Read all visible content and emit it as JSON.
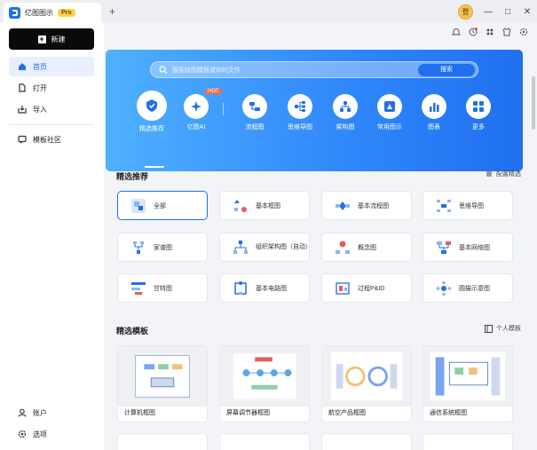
{
  "app": {
    "title": "亿图图示",
    "badge": "Pro",
    "new_tab_symbol": "+",
    "avatar_text": "登"
  },
  "window_controls": {
    "minimize": "—",
    "maximize": "□",
    "close": "✕"
  },
  "sidebar": {
    "new_button": "新建",
    "items": [
      {
        "label": "首页",
        "icon": "home-icon",
        "active": true
      },
      {
        "label": "打开",
        "icon": "open-file-icon"
      },
      {
        "label": "导入",
        "icon": "import-icon"
      },
      {
        "label": "模板社区",
        "icon": "community-icon"
      }
    ],
    "bottom": [
      {
        "label": "账户",
        "icon": "account-icon"
      },
      {
        "label": "选项",
        "icon": "settings-icon"
      }
    ]
  },
  "search": {
    "placeholder": "搜索绘图模板或你的文件",
    "button": "搜索"
  },
  "categories": [
    {
      "label": "精选推荐",
      "icon": "recommend-icon"
    },
    {
      "label": "亿图AI",
      "icon": "ai-icon",
      "badge": "HOT"
    },
    {
      "label": "流程图",
      "icon": "flowchart-icon"
    },
    {
      "label": "思维导图",
      "icon": "mindmap-icon"
    },
    {
      "label": "架构图",
      "icon": "architecture-icon"
    },
    {
      "label": "常用图示",
      "icon": "common-diagram-icon"
    },
    {
      "label": "图表",
      "icon": "chart-icon"
    },
    {
      "label": "更多",
      "icon": "more-icon"
    }
  ],
  "featured": {
    "title": "精选推荐",
    "config_link": "配置精选",
    "items": [
      {
        "label": "全部"
      },
      {
        "label": "基本框图"
      },
      {
        "label": "基本流程图"
      },
      {
        "label": "思维导图"
      },
      {
        "label": "家谱图"
      },
      {
        "label": "组织架构图（自动）"
      },
      {
        "label": "概念图"
      },
      {
        "label": "基本网络图"
      },
      {
        "label": "甘特图"
      },
      {
        "label": "基本电路图"
      },
      {
        "label": "过程P&ID"
      },
      {
        "label": "圆猫示意图"
      }
    ]
  },
  "templates": {
    "title": "精选模板",
    "personal_link": "个人模板",
    "items": [
      {
        "label": "计算机框图"
      },
      {
        "label": "屏幕调节器框图"
      },
      {
        "label": "航空产品框图"
      },
      {
        "label": "通信系统框图"
      }
    ]
  },
  "colors": {
    "accent": "#1f6fef",
    "hero_start": "#4fb0ff",
    "hero_end": "#1f6fef",
    "hot": "#ff6a3d"
  }
}
